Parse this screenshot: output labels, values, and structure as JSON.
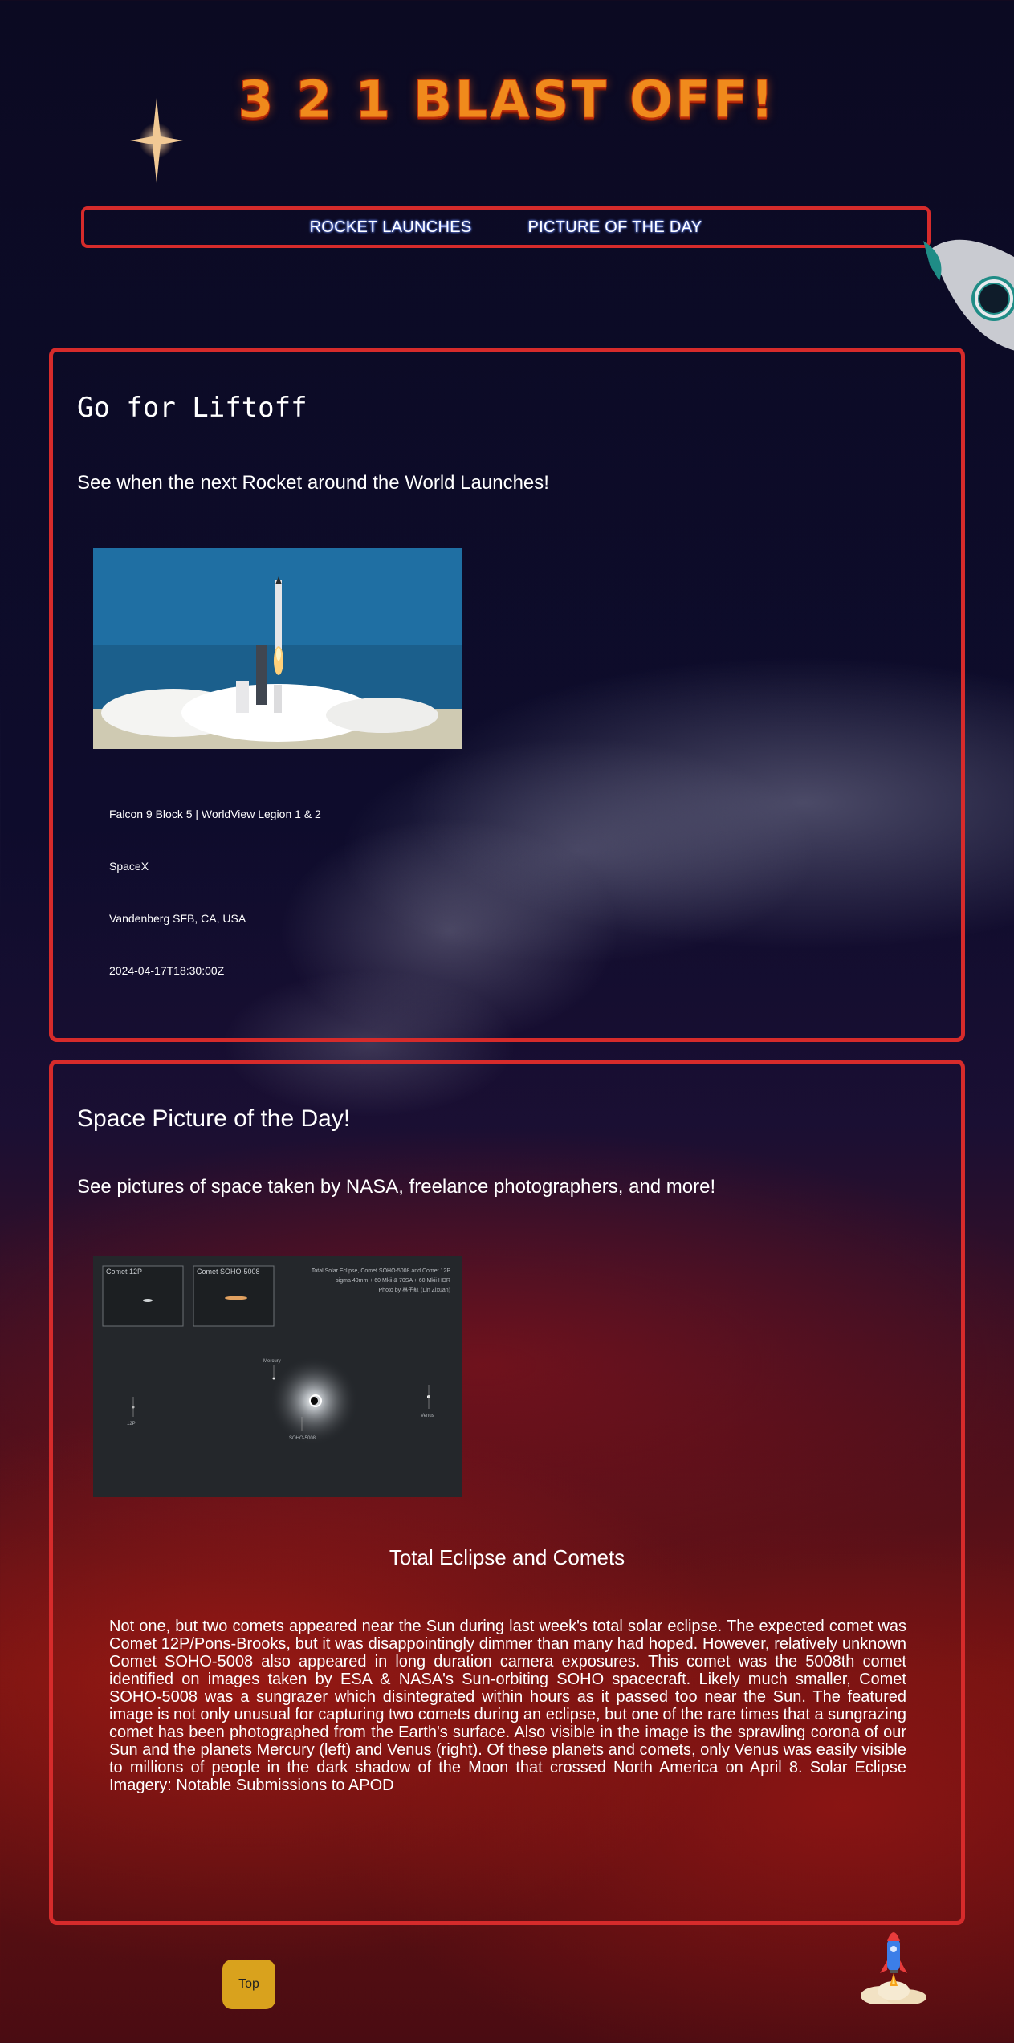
{
  "header": {
    "title": "3 2 1 BLAST OFF!"
  },
  "nav": {
    "items": [
      "ROCKET LAUNCHES",
      "PICTURE OF THE DAY"
    ]
  },
  "launches": {
    "heading": "Go for Liftoff",
    "subheading": "See when the next Rocket around the World Launches!",
    "mission": "Falcon 9 Block 5 | WorldView Legion 1 & 2",
    "provider": "SpaceX",
    "location": "Vandenberg SFB, CA, USA",
    "date": "2024-04-17T18:30:00Z"
  },
  "apod": {
    "heading": "Space Picture of the Day!",
    "subheading": "See pictures of space taken by NASA, freelance photographers, and more!",
    "image_caption": {
      "inset1": "Comet 12P",
      "inset2": "Comet SOHO-5008",
      "line1": "Total Solar Eclipse, Comet SOHO-5008 and Comet 12P",
      "line2": "sigma 40mm + 60 Mkii & 70SA + 60 Mkii HDR",
      "line3": "Photo by 林子航 (Lin Zixuan)",
      "mercury": "Mercury",
      "p12": "12P",
      "soho": "SOHO-5008",
      "venus": "Venus"
    },
    "title": "Total Eclipse and Comets",
    "explanation": "Not one, but two comets appeared near the Sun during last week's total solar eclipse. The expected comet was Comet 12P/Pons-Brooks, but it was disappointingly dimmer than many had hoped. However, relatively unknown Comet SOHO-5008 also appeared in long duration camera exposures. This comet was the 5008th comet identified on images taken by ESA & NASA's Sun-orbiting SOHO spacecraft. Likely much smaller, Comet SOHO-5008 was a sungrazer which disintegrated within hours as it passed too near the Sun. The featured image is not only unusual for capturing two comets during an eclipse, but one of the rare times that a sungrazing comet has been photographed from the Earth's surface. Also visible in the image is the sprawling corona of our Sun and the planets Mercury (left) and Venus (right). Of these planets and comets, only Venus was easily visible to millions of people in the dark shadow of the Moon that crossed North America on April 8. Solar Eclipse Imagery: Notable Submissions to APOD"
  },
  "footer": {
    "top_button": "Top"
  },
  "colors": {
    "accent_border": "#d62b2b",
    "title_orange": "#f08a1c",
    "button_gold": "#d9a21d"
  },
  "icons": [
    "sparkle-star-icon",
    "rocket-porthole-icon",
    "rocket-launch-icon"
  ]
}
